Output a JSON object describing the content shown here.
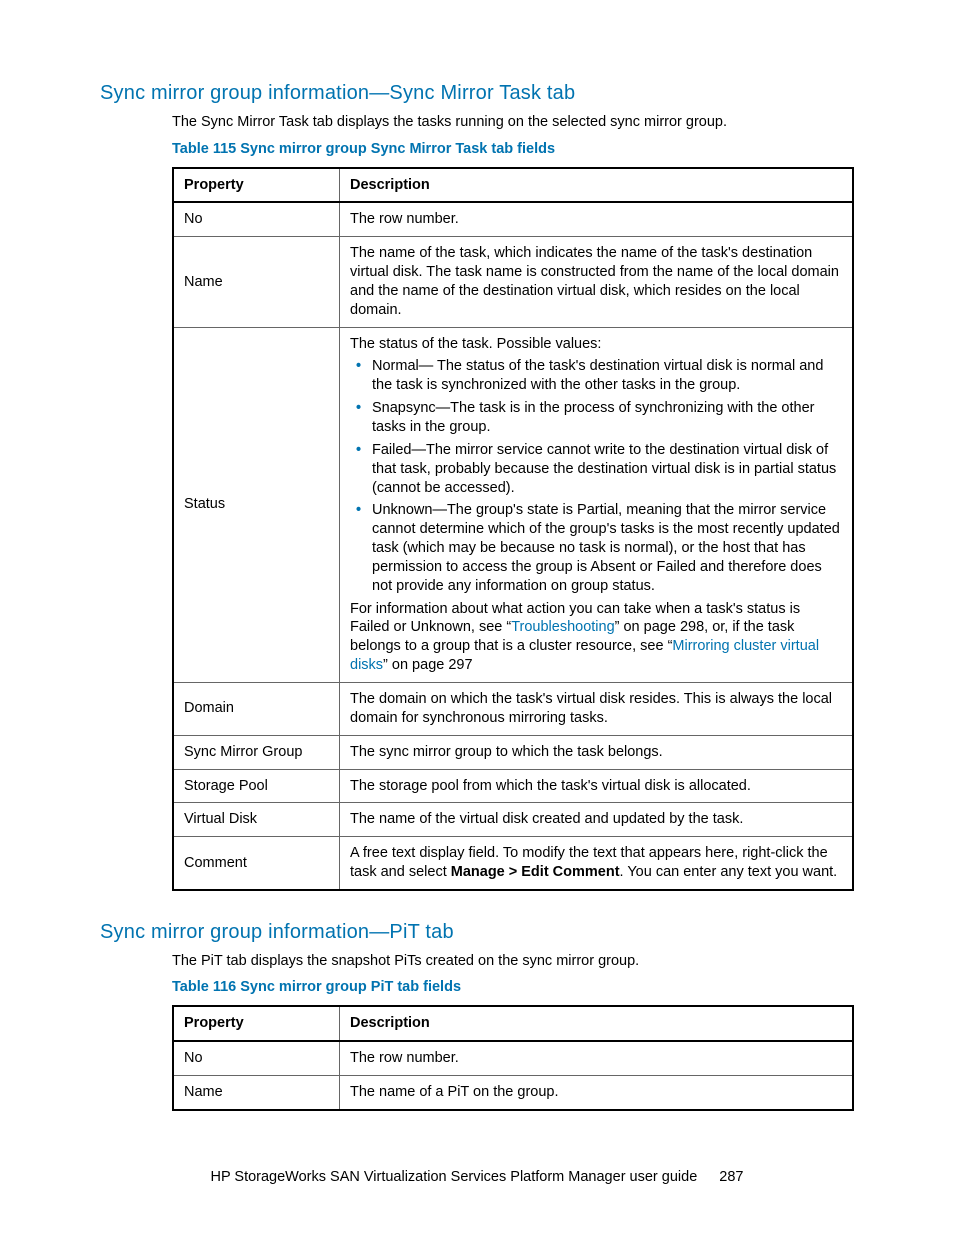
{
  "section1": {
    "heading": "Sync mirror group information—Sync Mirror Task tab",
    "description": "The Sync Mirror Task tab displays the tasks running on the selected sync mirror group.",
    "table_caption": "Table 115 Sync mirror group Sync Mirror Task tab fields",
    "col1": "Property",
    "col2": "Description",
    "rows": {
      "r1p": "No",
      "r1d": "The row number.",
      "r2p": "Name",
      "r2d": "The name of the task, which indicates the name of the task's destination virtual disk. The task name is constructed from the name of the local domain and the name of the destination virtual disk, which resides on the local domain.",
      "r3p": "Status",
      "r3d_intro": "The status of the task. Possible values:",
      "r3d_b1": "Normal— The status of the task's destination virtual disk is normal and the task is synchronized with the other tasks in the group.",
      "r3d_b2": "Snapsync—The task is in the process of synchronizing with the other tasks in the group.",
      "r3d_b3": "Failed—The mirror service cannot write to the destination virtual disk of that task, probably because the destination virtual disk is in partial status (cannot be accessed).",
      "r3d_b4": "Unknown—The group's state is Partial, meaning that the mirror service cannot determine which of the group's tasks is the most recently updated task (which may be because no task is normal), or the host that has permission to access the group is Absent or Failed and therefore does not provide any information on group status.",
      "r3d_tail1": "For information about what action you can take when a task's status is Failed or Unknown, see “",
      "r3d_link1": "Troubleshooting",
      "r3d_tail2": "” on page 298, or, if the task belongs to a group that is a cluster resource, see “",
      "r3d_link2": "Mirroring cluster virtual disks",
      "r3d_tail3": "” on page 297",
      "r4p": "Domain",
      "r4d": "The domain on which the task's virtual disk resides. This is always the local domain for synchronous mirroring tasks.",
      "r5p": "Sync Mirror Group",
      "r5d": "The sync mirror group to which the task belongs.",
      "r6p": "Storage Pool",
      "r6d": "The storage pool from which the task's virtual disk is allocated.",
      "r7p": "Virtual Disk",
      "r7d": "The name of the virtual disk created and updated by the task.",
      "r8p": "Comment",
      "r8d_a": "A free text display field. To modify the text that appears here, right-click the task and select ",
      "r8d_bold": "Manage > Edit Comment",
      "r8d_b": ". You can enter any text you want."
    }
  },
  "section2": {
    "heading": "Sync mirror group information—PiT tab",
    "description": "The PiT tab displays the snapshot PiTs created on the sync mirror group.",
    "table_caption": "Table 116 Sync mirror group PiT tab fields",
    "col1": "Property",
    "col2": "Description",
    "rows": {
      "r1p": "No",
      "r1d": "The row number.",
      "r2p": "Name",
      "r2d": "The name of a PiT on the group."
    }
  },
  "footer": {
    "title": "HP StorageWorks SAN Virtualization Services Platform Manager user guide",
    "page": "287"
  }
}
